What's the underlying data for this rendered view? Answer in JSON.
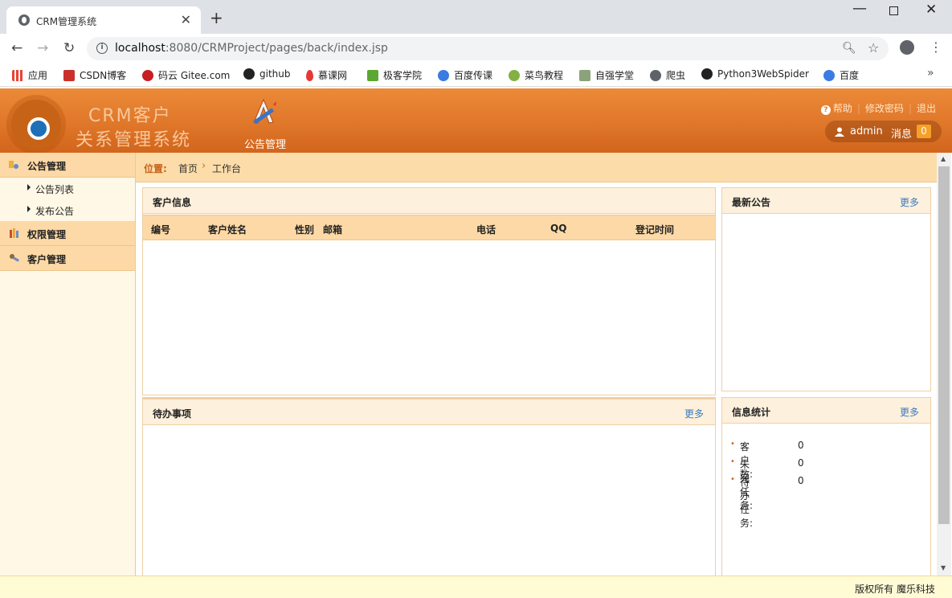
{
  "browser": {
    "tab_title": "CRM管理系统",
    "url_host": "localhost",
    "url_rest": ":8080/CRMProject/pages/back/index.jsp",
    "bookmarks": [
      {
        "label": "应用",
        "icon": "apps-grid-icon",
        "color": "#e94235"
      },
      {
        "label": "CSDN博客",
        "icon": "csdn-icon",
        "color": "#c9302c"
      },
      {
        "label": "码云 Gitee.com",
        "icon": "gitee-icon",
        "color": "#c71d23"
      },
      {
        "label": "github",
        "icon": "github-icon",
        "color": "#222222"
      },
      {
        "label": "慕课网",
        "icon": "flame-icon",
        "color": "#e53935"
      },
      {
        "label": "极客学院",
        "icon": "jike-icon",
        "color": "#5aa832"
      },
      {
        "label": "百度传课",
        "icon": "paw-icon",
        "color": "#3b7be3"
      },
      {
        "label": "菜鸟教程",
        "icon": "runoob-icon",
        "color": "#84b043"
      },
      {
        "label": "自强学堂",
        "icon": "ziqiang-icon",
        "color": "#8aa37a"
      },
      {
        "label": "爬虫",
        "icon": "globe-icon",
        "color": "#5f6368"
      },
      {
        "label": "Python3WebSpider",
        "icon": "github-icon",
        "color": "#222222"
      },
      {
        "label": "百度",
        "icon": "paw-icon",
        "color": "#3b7be3"
      }
    ]
  },
  "app": {
    "logo_line1": "CRM客户",
    "logo_line2": "关系管理系统",
    "nav_label": "公告管理",
    "links": {
      "help": "帮助",
      "change_pwd": "修改密码",
      "logout": "退出"
    },
    "user": {
      "name": "admin",
      "msg_label": "消息",
      "msg_count": "0"
    },
    "colors": {
      "header": "#e07b2c",
      "accent": "#d2651c",
      "link": "#3b7bc0",
      "badge": "#f5a02a"
    }
  },
  "sidebar": {
    "groups": [
      {
        "label": "公告管理",
        "icon": "notice-icon",
        "items": [
          "公告列表",
          "发布公告"
        ]
      },
      {
        "label": "权限管理",
        "icon": "permission-icon",
        "items": []
      },
      {
        "label": "客户管理",
        "icon": "customer-icon",
        "items": []
      }
    ]
  },
  "breadcrumb": {
    "prefix": "位置:",
    "home": "首页",
    "current": "工作台"
  },
  "panels": {
    "customers": {
      "title": "客户信息",
      "columns": [
        "编号",
        "客户姓名",
        "性别",
        "邮箱",
        "电话",
        "QQ",
        "登记时间"
      ]
    },
    "notices": {
      "title": "最新公告",
      "more": "更多"
    },
    "todo": {
      "title": "待办事项",
      "more": "更多"
    },
    "stats": {
      "title": "信息统计",
      "more": "更多",
      "rows": [
        {
          "label": "客户数:",
          "value": "0"
        },
        {
          "label": "未完任务:",
          "value": "0"
        },
        {
          "label": "待办任务:",
          "value": "0"
        }
      ]
    }
  },
  "footer": {
    "copyright": "版权所有 魔乐科技"
  }
}
